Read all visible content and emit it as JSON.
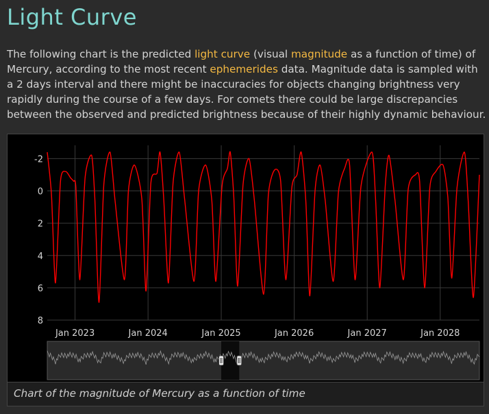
{
  "page": {
    "heading": "Light Curve",
    "intro": {
      "t1": "The following chart is the predicted ",
      "link1": "light curve",
      "t2": " (visual ",
      "link2": "magnitude",
      "t3": " as a function of time) of Mercury, according to the most recent ",
      "link3": "ephemerides",
      "t4": " data. Magnitude data is sampled with a 2 days interval and there might be inaccuracies for objects changing brightness very rapidly during the course of a few days. For comets there could be large discrepancies between the observed and predicted brightness because of their highly dynamic behaviour."
    },
    "caption": "Chart of the magnitude of Mercury as a function of time"
  },
  "colors": {
    "heading": "#7fd6cf",
    "link": "#f5b942",
    "series": "#ff0000",
    "navigator": "#9a9a9a"
  },
  "chart_data": {
    "type": "line",
    "series": [
      {
        "name": "",
        "color": "#ff0000"
      }
    ],
    "x_range": [
      "2022-08-15",
      "2028-07-15"
    ],
    "y_reversed": true,
    "ylim": [
      -2.4,
      8
    ],
    "yticks": [
      -2,
      0,
      2,
      4,
      6,
      8
    ],
    "ytick_labels": [
      "-2",
      "0",
      "2",
      "4",
      "6",
      "8"
    ],
    "xticks": [
      "2023-01-01",
      "2024-01-01",
      "2025-01-01",
      "2026-01-01",
      "2027-01-01",
      "2028-01-01"
    ],
    "xtick_labels": [
      "Jan 2023",
      "Jan 2024",
      "Jan 2025",
      "Jan 2026",
      "Jan 2027",
      "Jan 2028"
    ],
    "grid": true,
    "navigator": {
      "visible": true,
      "selection": [
        "2025-01-01",
        "2025-04-01"
      ]
    },
    "points": [
      [
        "2022-08-15",
        -2.4
      ],
      [
        "2022-09-05",
        0.2
      ],
      [
        "2022-09-25",
        5.7
      ],
      [
        "2022-10-20",
        -0.6
      ],
      [
        "2022-11-15",
        -1.2
      ],
      [
        "2022-12-10",
        -0.8
      ],
      [
        "2022-12-25",
        -0.6
      ],
      [
        "2023-01-05",
        -0.2
      ],
      [
        "2023-01-25",
        5.5
      ],
      [
        "2023-02-20",
        -0.8
      ],
      [
        "2023-03-25",
        -2.2
      ],
      [
        "2023-04-10",
        0.5
      ],
      [
        "2023-05-01",
        6.9
      ],
      [
        "2023-05-25",
        -0.4
      ],
      [
        "2023-06-25",
        -2.4
      ],
      [
        "2023-07-20",
        0.6
      ],
      [
        "2023-09-05",
        5.5
      ],
      [
        "2023-09-25",
        0.0
      ],
      [
        "2023-10-25",
        -1.6
      ],
      [
        "2023-12-01",
        0.5
      ],
      [
        "2023-12-22",
        6.2
      ],
      [
        "2024-01-15",
        -0.5
      ],
      [
        "2024-02-15",
        -1.1
      ],
      [
        "2024-03-01",
        -2.4
      ],
      [
        "2024-03-20",
        0.6
      ],
      [
        "2024-04-12",
        5.7
      ],
      [
        "2024-05-05",
        -0.5
      ],
      [
        "2024-06-05",
        -2.4
      ],
      [
        "2024-07-01",
        0.4
      ],
      [
        "2024-08-18",
        5.6
      ],
      [
        "2024-09-10",
        0.0
      ],
      [
        "2024-10-15",
        -1.6
      ],
      [
        "2024-11-15",
        0.6
      ],
      [
        "2024-12-05",
        5.6
      ],
      [
        "2025-01-05",
        -0.3
      ],
      [
        "2025-02-01",
        -1.4
      ],
      [
        "2025-02-15",
        -2.4
      ],
      [
        "2025-03-05",
        0.4
      ],
      [
        "2025-03-24",
        5.9
      ],
      [
        "2025-04-20",
        -0.4
      ],
      [
        "2025-05-20",
        -2.0
      ],
      [
        "2025-06-15",
        0.5
      ],
      [
        "2025-08-01",
        6.4
      ],
      [
        "2025-08-25",
        0.2
      ],
      [
        "2025-09-25",
        -1.3
      ],
      [
        "2025-10-25",
        -0.6
      ],
      [
        "2025-11-20",
        5.5
      ],
      [
        "2025-12-20",
        -0.2
      ],
      [
        "2026-01-15",
        -1.0
      ],
      [
        "2026-02-05",
        -2.4
      ],
      [
        "2026-02-28",
        0.6
      ],
      [
        "2026-03-20",
        6.5
      ],
      [
        "2026-04-15",
        0.0
      ],
      [
        "2026-05-10",
        -1.6
      ],
      [
        "2026-06-05",
        0.6
      ],
      [
        "2026-07-15",
        5.6
      ],
      [
        "2026-08-10",
        0.1
      ],
      [
        "2026-09-10",
        -1.4
      ],
      [
        "2026-10-05",
        -1.6
      ],
      [
        "2026-11-01",
        5.5
      ],
      [
        "2026-12-01",
        -0.3
      ],
      [
        "2027-01-25",
        -2.4
      ],
      [
        "2027-02-12",
        0.6
      ],
      [
        "2027-03-05",
        6.0
      ],
      [
        "2027-04-01",
        -0.3
      ],
      [
        "2027-04-20",
        -2.2
      ],
      [
        "2027-05-20",
        0.6
      ],
      [
        "2027-07-01",
        5.5
      ],
      [
        "2027-07-25",
        -0.1
      ],
      [
        "2027-08-30",
        -1.0
      ],
      [
        "2027-09-20",
        -0.6
      ],
      [
        "2027-10-15",
        6.0
      ],
      [
        "2027-11-10",
        -0.2
      ],
      [
        "2027-12-10",
        -1.2
      ],
      [
        "2028-01-15",
        -1.6
      ],
      [
        "2028-02-08",
        0.4
      ],
      [
        "2028-02-28",
        5.4
      ],
      [
        "2028-03-25",
        -0.2
      ],
      [
        "2028-05-01",
        -2.4
      ],
      [
        "2028-05-20",
        0.6
      ],
      [
        "2028-06-15",
        6.6
      ],
      [
        "2028-07-15",
        -1.0
      ]
    ]
  }
}
